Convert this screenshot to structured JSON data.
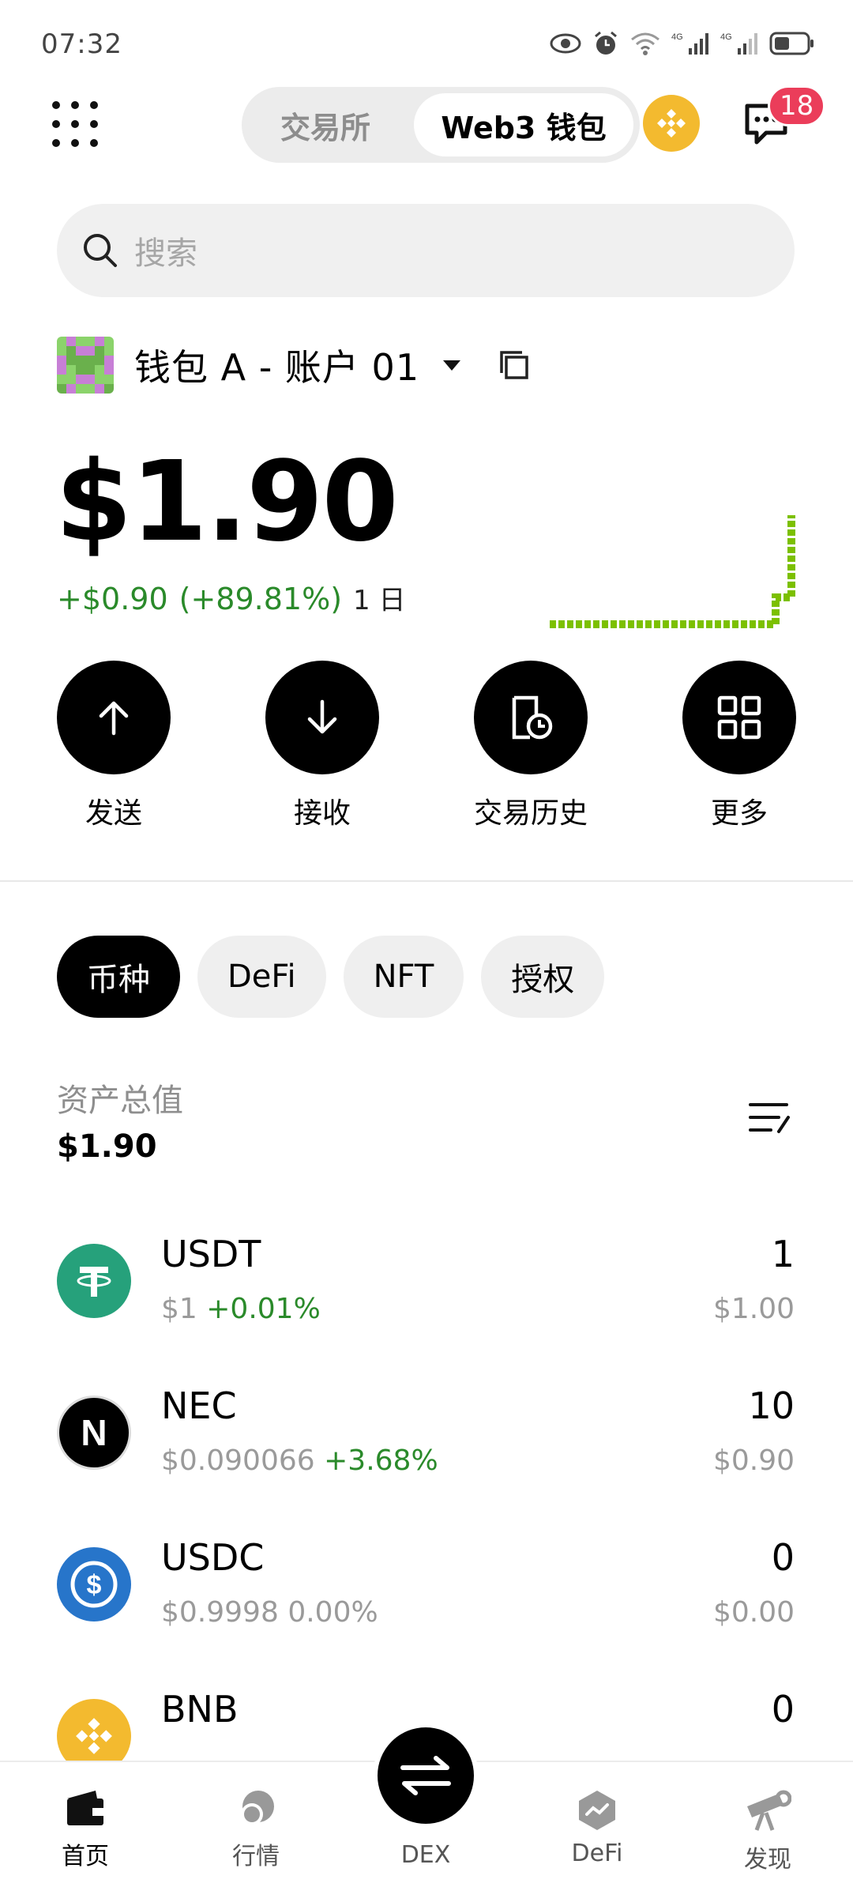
{
  "status_bar": {
    "time": "07:32",
    "battery_icon": "battery-icon",
    "signal_icon": "signal-icon"
  },
  "header": {
    "tabs": [
      {
        "label": "交易所",
        "active": false
      },
      {
        "label": "Web3 钱包",
        "active": true
      }
    ],
    "notification_count": "18"
  },
  "search": {
    "placeholder": "搜索"
  },
  "wallet": {
    "name": "钱包 A - 账户 01",
    "balance": "$1.90",
    "change_amount": "+$0.90",
    "change_pct": "(+89.81%)",
    "period": "1 日"
  },
  "actions": [
    {
      "label": "发送",
      "icon": "arrow-up-icon"
    },
    {
      "label": "接收",
      "icon": "arrow-down-icon"
    },
    {
      "label": "交易历史",
      "icon": "history-icon"
    },
    {
      "label": "更多",
      "icon": "grid-icon"
    }
  ],
  "asset_tabs": [
    {
      "label": "币种",
      "active": true
    },
    {
      "label": "DeFi",
      "active": false
    },
    {
      "label": "NFT",
      "active": false
    },
    {
      "label": "授权",
      "active": false
    }
  ],
  "totals": {
    "label": "资产总值",
    "value": "$1.90"
  },
  "tokens": [
    {
      "symbol": "USDT",
      "price": "$1",
      "change": "+0.01%",
      "qty": "1",
      "usd": "$1.00",
      "color": "#26a17b"
    },
    {
      "symbol": "NEC",
      "price": "$0.090066",
      "change": "+3.68%",
      "qty": "10",
      "usd": "$0.90",
      "color": "#000000"
    },
    {
      "symbol": "USDC",
      "price": "$0.9998",
      "change": "0.00%",
      "qty": "0",
      "usd": "$0.00",
      "color": "#2775ca"
    },
    {
      "symbol": "BNB",
      "price": "",
      "change": "",
      "qty": "0",
      "usd": "",
      "color": "#f3ba2f"
    }
  ],
  "bottom_nav": [
    {
      "label": "首页",
      "icon": "wallet-icon",
      "active": true
    },
    {
      "label": "行情",
      "icon": "market-icon",
      "active": false
    },
    {
      "label": "DEX",
      "icon": "swap-icon",
      "active": false
    },
    {
      "label": "DeFi",
      "icon": "defi-icon",
      "active": false
    },
    {
      "label": "发现",
      "icon": "telescope-icon",
      "active": false
    }
  ],
  "colors": {
    "accent_green": "#2a8a2a",
    "sparkline": "#7cc000",
    "badge": "#eb3d5a"
  }
}
